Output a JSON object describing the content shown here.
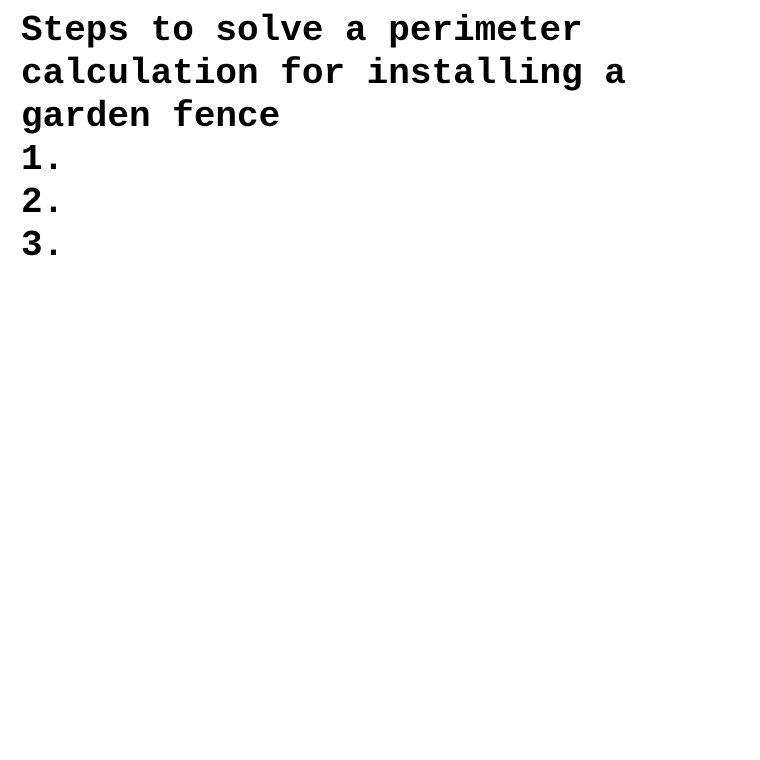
{
  "document": {
    "title": "Steps to solve a perimeter calculation for installing a garden fence",
    "steps": [
      {
        "number": "1.",
        "text": ""
      },
      {
        "number": "2.",
        "text": ""
      },
      {
        "number": "3.",
        "text": ""
      }
    ]
  }
}
